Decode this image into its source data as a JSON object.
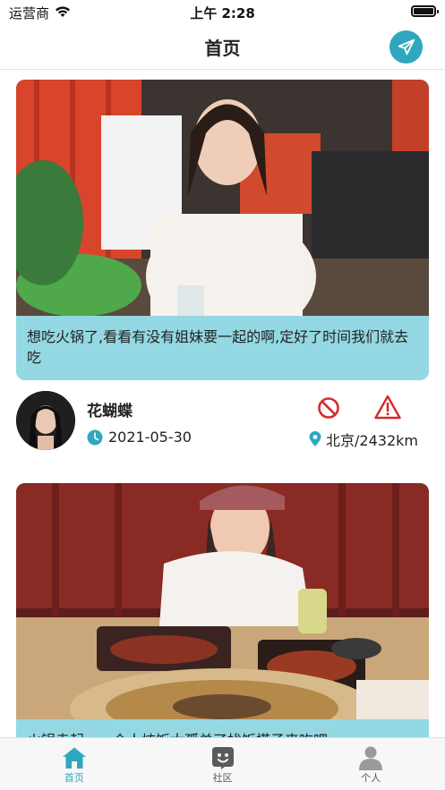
{
  "status_bar": {
    "carrier": "运营商",
    "time": "上午 2:28"
  },
  "nav": {
    "title": "首页"
  },
  "posts": [
    {
      "caption": "想吃火锅了,看看有没有姐妹要一起的啊,定好了时间我们就去吃",
      "username": "花蝴蝶",
      "date": "2021-05-30",
      "location": "北京/2432km"
    },
    {
      "caption": "火锅走起，一个人炫饭太孤单了找饭搭子来吃吧"
    }
  ],
  "tabs": [
    {
      "label": "首页",
      "icon": "home-icon",
      "active": true
    },
    {
      "label": "社区",
      "icon": "community-icon",
      "active": false
    },
    {
      "label": "个人",
      "icon": "person-icon",
      "active": false
    }
  ],
  "colors": {
    "accent": "#2ea7bf",
    "caption_bg": "#93d8e3",
    "danger": "#d42b2b"
  }
}
